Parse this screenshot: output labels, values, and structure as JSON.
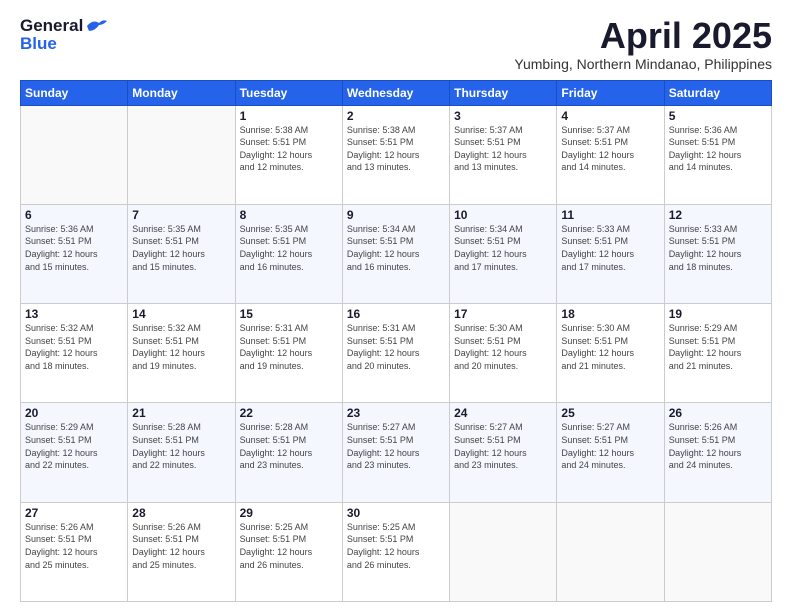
{
  "logo": {
    "general": "General",
    "blue": "Blue"
  },
  "title": "April 2025",
  "subtitle": "Yumbing, Northern Mindanao, Philippines",
  "days_header": [
    "Sunday",
    "Monday",
    "Tuesday",
    "Wednesday",
    "Thursday",
    "Friday",
    "Saturday"
  ],
  "weeks": [
    [
      {
        "day": "",
        "info": ""
      },
      {
        "day": "",
        "info": ""
      },
      {
        "day": "1",
        "info": "Sunrise: 5:38 AM\nSunset: 5:51 PM\nDaylight: 12 hours\nand 12 minutes."
      },
      {
        "day": "2",
        "info": "Sunrise: 5:38 AM\nSunset: 5:51 PM\nDaylight: 12 hours\nand 13 minutes."
      },
      {
        "day": "3",
        "info": "Sunrise: 5:37 AM\nSunset: 5:51 PM\nDaylight: 12 hours\nand 13 minutes."
      },
      {
        "day": "4",
        "info": "Sunrise: 5:37 AM\nSunset: 5:51 PM\nDaylight: 12 hours\nand 14 minutes."
      },
      {
        "day": "5",
        "info": "Sunrise: 5:36 AM\nSunset: 5:51 PM\nDaylight: 12 hours\nand 14 minutes."
      }
    ],
    [
      {
        "day": "6",
        "info": "Sunrise: 5:36 AM\nSunset: 5:51 PM\nDaylight: 12 hours\nand 15 minutes."
      },
      {
        "day": "7",
        "info": "Sunrise: 5:35 AM\nSunset: 5:51 PM\nDaylight: 12 hours\nand 15 minutes."
      },
      {
        "day": "8",
        "info": "Sunrise: 5:35 AM\nSunset: 5:51 PM\nDaylight: 12 hours\nand 16 minutes."
      },
      {
        "day": "9",
        "info": "Sunrise: 5:34 AM\nSunset: 5:51 PM\nDaylight: 12 hours\nand 16 minutes."
      },
      {
        "day": "10",
        "info": "Sunrise: 5:34 AM\nSunset: 5:51 PM\nDaylight: 12 hours\nand 17 minutes."
      },
      {
        "day": "11",
        "info": "Sunrise: 5:33 AM\nSunset: 5:51 PM\nDaylight: 12 hours\nand 17 minutes."
      },
      {
        "day": "12",
        "info": "Sunrise: 5:33 AM\nSunset: 5:51 PM\nDaylight: 12 hours\nand 18 minutes."
      }
    ],
    [
      {
        "day": "13",
        "info": "Sunrise: 5:32 AM\nSunset: 5:51 PM\nDaylight: 12 hours\nand 18 minutes."
      },
      {
        "day": "14",
        "info": "Sunrise: 5:32 AM\nSunset: 5:51 PM\nDaylight: 12 hours\nand 19 minutes."
      },
      {
        "day": "15",
        "info": "Sunrise: 5:31 AM\nSunset: 5:51 PM\nDaylight: 12 hours\nand 19 minutes."
      },
      {
        "day": "16",
        "info": "Sunrise: 5:31 AM\nSunset: 5:51 PM\nDaylight: 12 hours\nand 20 minutes."
      },
      {
        "day": "17",
        "info": "Sunrise: 5:30 AM\nSunset: 5:51 PM\nDaylight: 12 hours\nand 20 minutes."
      },
      {
        "day": "18",
        "info": "Sunrise: 5:30 AM\nSunset: 5:51 PM\nDaylight: 12 hours\nand 21 minutes."
      },
      {
        "day": "19",
        "info": "Sunrise: 5:29 AM\nSunset: 5:51 PM\nDaylight: 12 hours\nand 21 minutes."
      }
    ],
    [
      {
        "day": "20",
        "info": "Sunrise: 5:29 AM\nSunset: 5:51 PM\nDaylight: 12 hours\nand 22 minutes."
      },
      {
        "day": "21",
        "info": "Sunrise: 5:28 AM\nSunset: 5:51 PM\nDaylight: 12 hours\nand 22 minutes."
      },
      {
        "day": "22",
        "info": "Sunrise: 5:28 AM\nSunset: 5:51 PM\nDaylight: 12 hours\nand 23 minutes."
      },
      {
        "day": "23",
        "info": "Sunrise: 5:27 AM\nSunset: 5:51 PM\nDaylight: 12 hours\nand 23 minutes."
      },
      {
        "day": "24",
        "info": "Sunrise: 5:27 AM\nSunset: 5:51 PM\nDaylight: 12 hours\nand 23 minutes."
      },
      {
        "day": "25",
        "info": "Sunrise: 5:27 AM\nSunset: 5:51 PM\nDaylight: 12 hours\nand 24 minutes."
      },
      {
        "day": "26",
        "info": "Sunrise: 5:26 AM\nSunset: 5:51 PM\nDaylight: 12 hours\nand 24 minutes."
      }
    ],
    [
      {
        "day": "27",
        "info": "Sunrise: 5:26 AM\nSunset: 5:51 PM\nDaylight: 12 hours\nand 25 minutes."
      },
      {
        "day": "28",
        "info": "Sunrise: 5:26 AM\nSunset: 5:51 PM\nDaylight: 12 hours\nand 25 minutes."
      },
      {
        "day": "29",
        "info": "Sunrise: 5:25 AM\nSunset: 5:51 PM\nDaylight: 12 hours\nand 26 minutes."
      },
      {
        "day": "30",
        "info": "Sunrise: 5:25 AM\nSunset: 5:51 PM\nDaylight: 12 hours\nand 26 minutes."
      },
      {
        "day": "",
        "info": ""
      },
      {
        "day": "",
        "info": ""
      },
      {
        "day": "",
        "info": ""
      }
    ]
  ]
}
